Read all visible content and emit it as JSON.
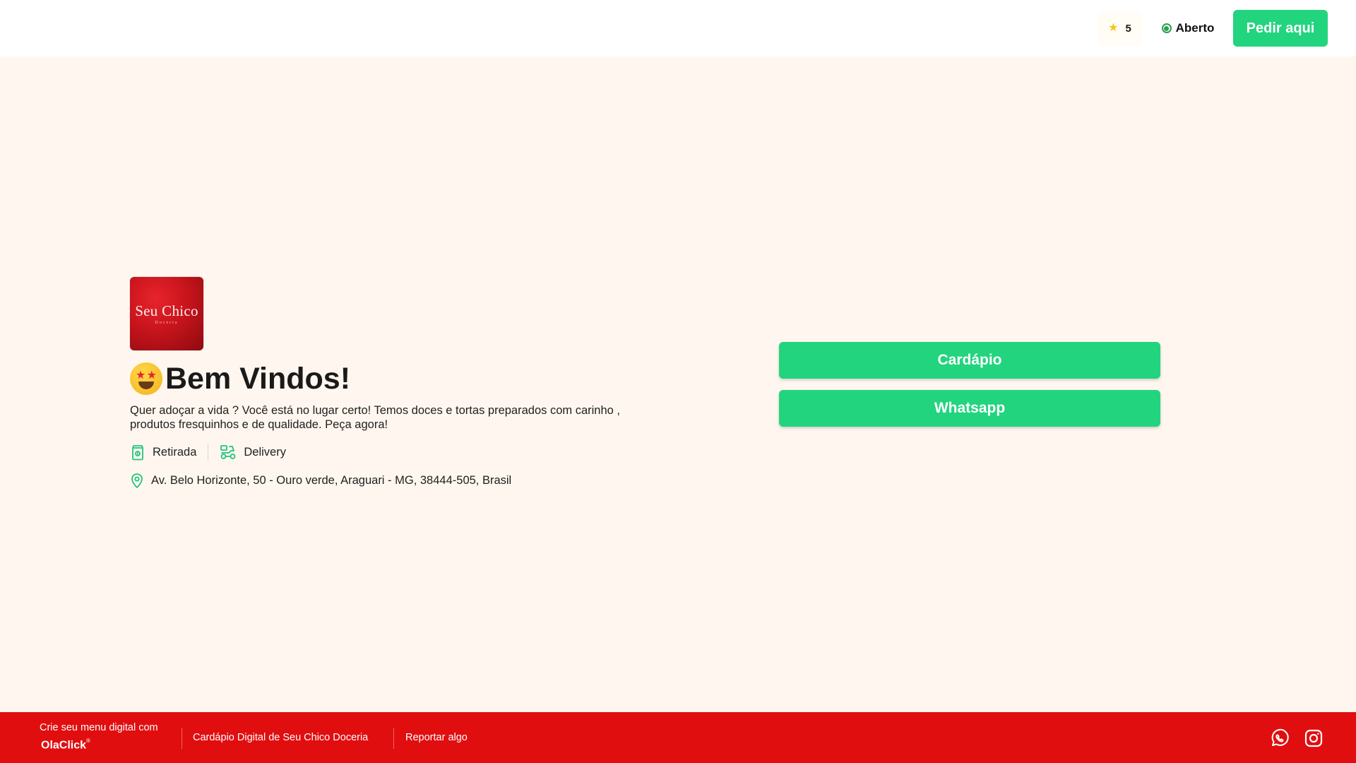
{
  "header": {
    "rating": {
      "icon": "star-icon",
      "value": "5"
    },
    "status": {
      "icon": "open-status-icon",
      "label": "Aberto"
    },
    "order_button": "Pedir aqui"
  },
  "hero": {
    "logo": {
      "title": "Seu Chico",
      "subtitle": "Doceria"
    },
    "welcome": {
      "emoji": "star-struck-emoji-icon",
      "title": "Bem Vindos!"
    },
    "description": "Quer adoçar a vida ? Você está no lugar certo! Temos doces e tortas preparados com carinho , produtos fresquinhos e de qualidade. Peça agora!",
    "services": [
      {
        "icon": "pickup-bag-icon",
        "label": "Retirada"
      },
      {
        "icon": "delivery-scooter-icon",
        "label": "Delivery"
      }
    ],
    "address": {
      "icon": "location-pin-icon",
      "text": "Av. Belo Horizonte, 50 - Ouro verde, Araguari - MG, 38444-505, Brasil"
    }
  },
  "actions": {
    "menu_button": "Cardápio",
    "whatsapp_button": "Whatsapp"
  },
  "footer": {
    "cta": "Crie seu menu digital com",
    "brand": "OlaClick",
    "brand_mark": "®",
    "digital_menu_link": "Cardápio Digital de Seu Chico Doceria",
    "report_link": "Reportar algo",
    "social": [
      "whatsapp-icon",
      "instagram-icon"
    ]
  },
  "colors": {
    "page_background": "#FFF7EF",
    "accent_green": "#22D47E",
    "footer_red": "#E10E10",
    "status_green": "#2E9E4F",
    "star_yellow": "#F5C518"
  }
}
